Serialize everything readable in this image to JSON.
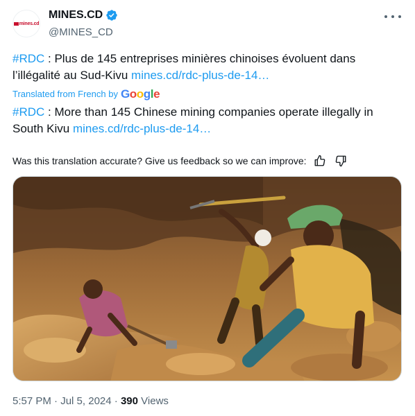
{
  "author": {
    "display_name": "MINES.CD",
    "handle": "@MINES_CD",
    "avatar_text": "mines.cd",
    "verified": true,
    "verified_color": "#1d9bf0"
  },
  "tweet": {
    "original": {
      "hashtag": "#RDC",
      "text": " : Plus de 145 entreprises minières chinoises évoluent dans l’illégalité au Sud-Kivu ",
      "link": "mines.cd/rdc-plus-de-14…"
    },
    "translation_label": "Translated from French by",
    "translation_provider": "Google",
    "translated": {
      "hashtag": "#RDC",
      "text": " : More than 145 Chinese mining companies operate illegally in South Kivu ",
      "link": "mines.cd/rdc-plus-de-14…"
    },
    "feedback_prompt": "Was this translation accurate? Give us feedback so we can improve:",
    "time": "5:57 PM",
    "separator": "·",
    "date": "Jul 5, 2024",
    "views_count": "390",
    "views_label": "Views"
  },
  "icons": {
    "more": "more-icon",
    "thumbs_up": "thumbs-up-icon",
    "thumbs_down": "thumbs-down-icon",
    "verified": "verified-badge-icon"
  },
  "colors": {
    "accent": "#1d9bf0",
    "text": "#0f1419",
    "muted": "#536471"
  }
}
